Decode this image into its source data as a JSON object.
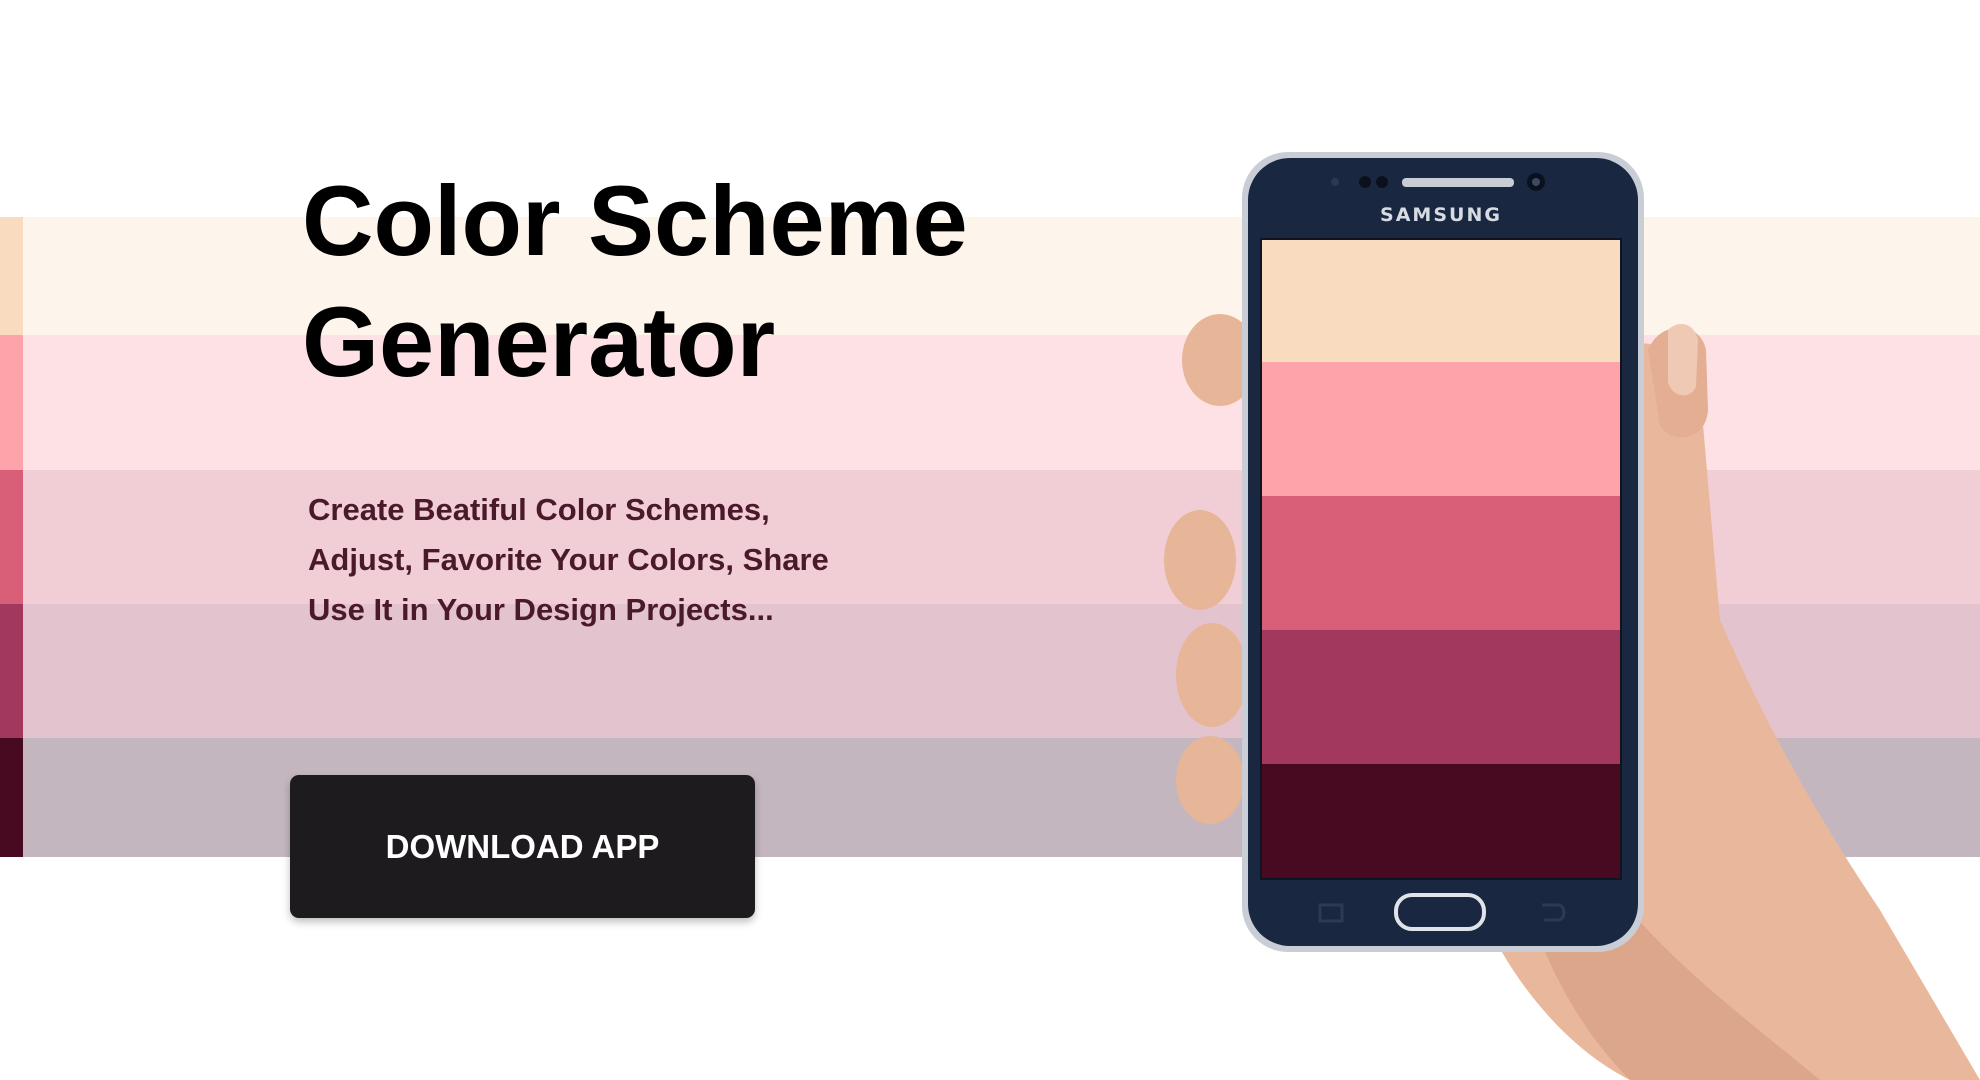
{
  "hero": {
    "title": "Color Scheme Generator",
    "subtitle_lines": [
      "Create Beatiful Color Schemes,",
      "Adjust, Favorite Your Colors, Share",
      "Use It in Your Design Projects..."
    ],
    "download_label": "DOWNLOAD APP"
  },
  "phone": {
    "brand": "SAMSUNG"
  },
  "palette": [
    {
      "color": "#f9dbc0",
      "tint": "#fdf4ec"
    },
    {
      "color": "#fea3aa",
      "tint": "#fde1e5"
    },
    {
      "color": "#d95f78",
      "tint": "#f1ced6"
    },
    {
      "color": "#a3385e",
      "tint": "#e3c3ce"
    },
    {
      "color": "#480a20",
      "tint": "#c4b6bf"
    }
  ]
}
